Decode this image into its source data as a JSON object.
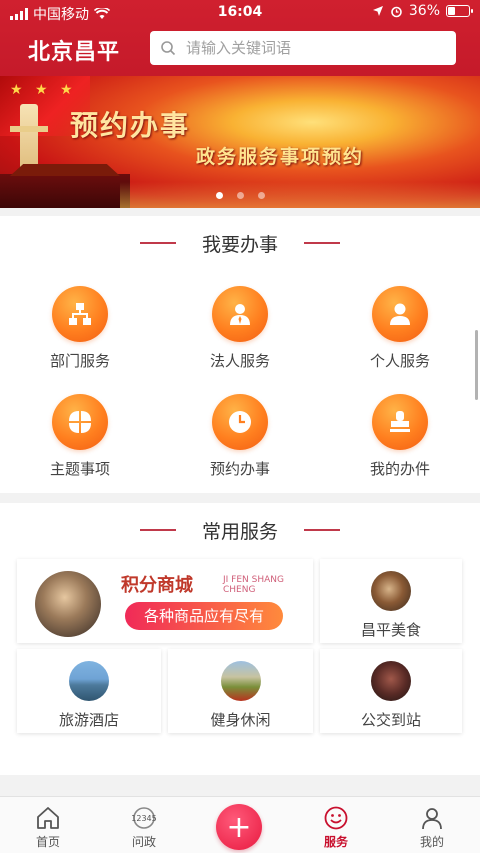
{
  "status_bar": {
    "carrier": "中国移动",
    "time": "16:04",
    "battery": "36%",
    "battery_level": 0.36
  },
  "header": {
    "logo": "北京昌平",
    "search_placeholder": "请输入关键词语"
  },
  "banner": {
    "title": "预约办事",
    "subtitle": "政务服务事项预约",
    "slides": 3,
    "active_slide": 1
  },
  "section1": {
    "title": "我要办事",
    "items": [
      {
        "label": "部门服务",
        "icon": "org-chart-icon"
      },
      {
        "label": "法人服务",
        "icon": "legal-person-icon"
      },
      {
        "label": "个人服务",
        "icon": "person-icon"
      },
      {
        "label": "主题事项",
        "icon": "theme-icon"
      },
      {
        "label": "预约办事",
        "icon": "clock-icon"
      },
      {
        "label": "我的办件",
        "icon": "stamp-icon"
      }
    ]
  },
  "section2": {
    "title": "常用服务",
    "mall": {
      "title": "积分商城",
      "en": "JI FEN SHANG CHENG",
      "pill": "各种商品应有尽有"
    },
    "tiles": [
      {
        "label": "昌平美食",
        "icon": "food-icon"
      },
      {
        "label": "旅游酒店",
        "icon": "hotel-icon"
      },
      {
        "label": "健身休闲",
        "icon": "fitness-icon"
      },
      {
        "label": "公交到站",
        "icon": "bus-icon"
      }
    ]
  },
  "tabbar": {
    "tabs": [
      {
        "label": "首页",
        "icon": "home-icon"
      },
      {
        "label": "问政",
        "icon": "12345-icon",
        "badge": "12345"
      },
      {
        "label": "服务",
        "icon": "smile-icon",
        "active": true
      },
      {
        "label": "我的",
        "icon": "user-icon"
      }
    ],
    "center_button": "+"
  },
  "colors": {
    "brand_red": "#c8102e",
    "orange": "#ff7f1f",
    "pink": "#f02a58"
  }
}
